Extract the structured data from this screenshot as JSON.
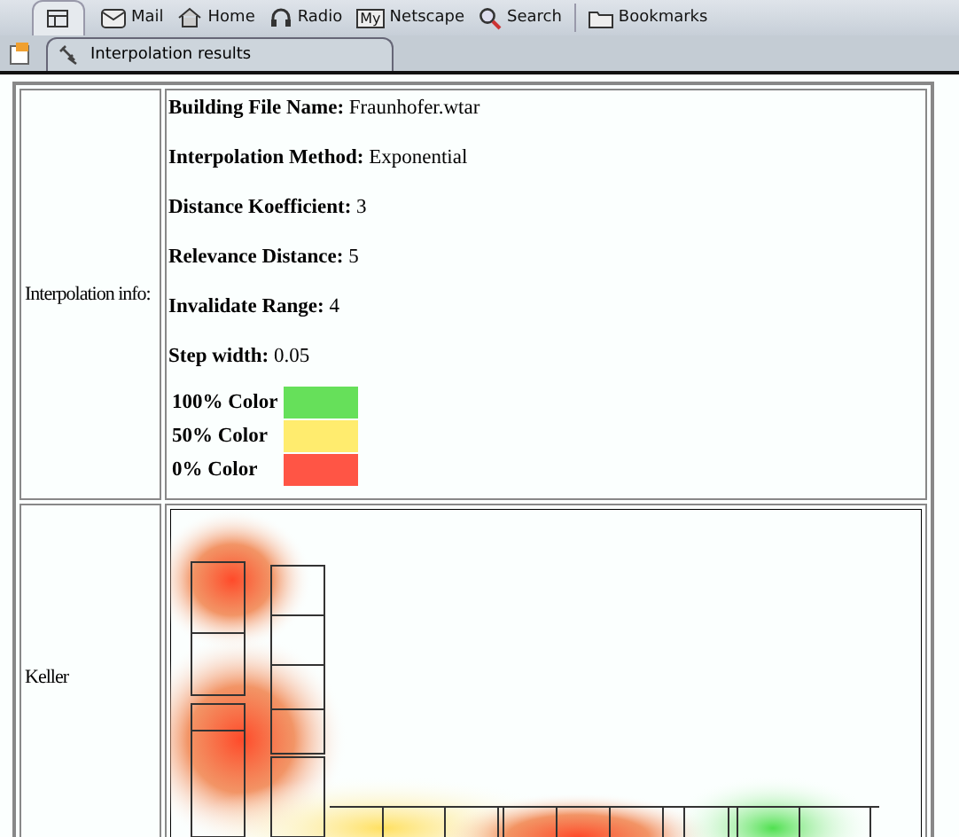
{
  "toolbar": {
    "items": [
      {
        "kind": "tab-icon"
      },
      {
        "kind": "mail",
        "label": "Mail"
      },
      {
        "kind": "home",
        "label": "Home"
      },
      {
        "kind": "radio",
        "label": "Radio"
      },
      {
        "kind": "my",
        "label": "Netscape",
        "badge": "My"
      },
      {
        "kind": "search",
        "label": "Search"
      },
      {
        "kind": "bookmarks",
        "label": "Bookmarks"
      }
    ]
  },
  "tab": {
    "title": "Interpolation results",
    "selected": true
  },
  "info": {
    "label": "Interpolation info:",
    "fields": [
      {
        "name": "Building File Name:",
        "value": "Fraunhofer.wtar"
      },
      {
        "name": "Interpolation Method:",
        "value": "Exponential"
      },
      {
        "name": "Distance Koefficient:",
        "value": "3"
      },
      {
        "name": "Relevance Distance:",
        "value": "5"
      },
      {
        "name": "Invalidate Range:",
        "value": "4"
      },
      {
        "name": "Step width:",
        "value": "0.05"
      }
    ],
    "legend": [
      {
        "label": "100% Color",
        "color": "#66e05a"
      },
      {
        "label": "50% Color",
        "color": "#ffec6e"
      },
      {
        "label": "0% Color",
        "color": "#ff5545"
      }
    ]
  },
  "floor": {
    "label": "Keller"
  }
}
